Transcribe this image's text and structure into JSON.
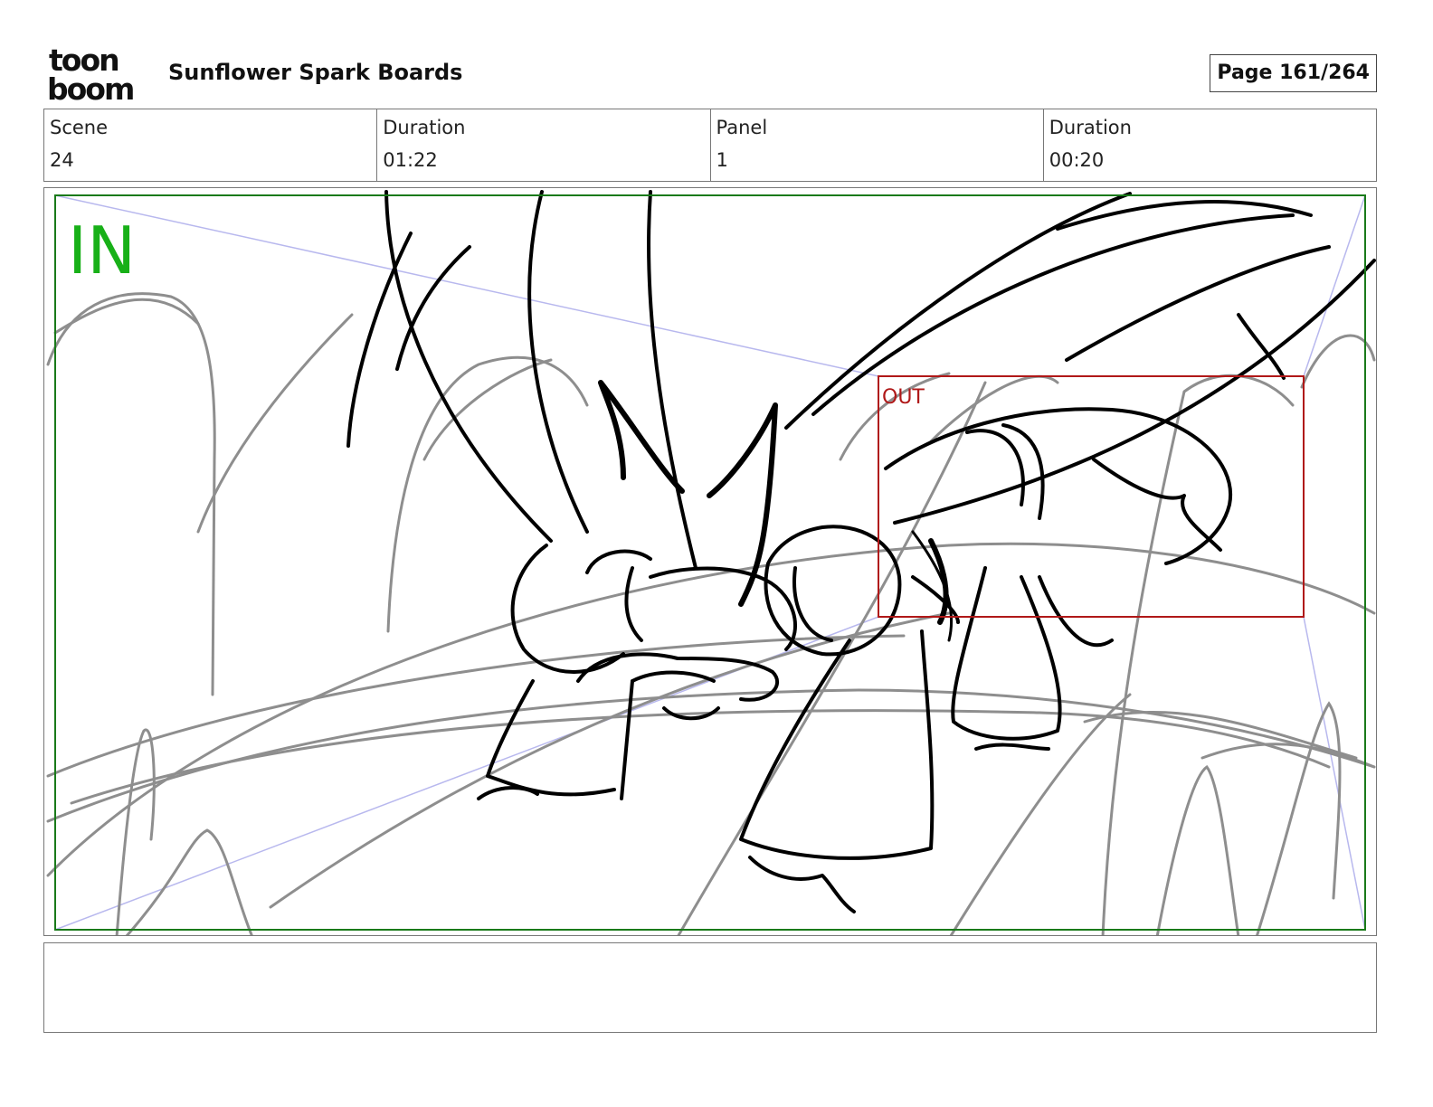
{
  "header": {
    "logo_text_top": "toon",
    "logo_text_bottom": "boom",
    "project_title": "Sunflower Spark Boards",
    "page_indicator": "Page 161/264"
  },
  "info": {
    "scene_label": "Scene",
    "scene_value": "24",
    "scene_duration_label": "Duration",
    "scene_duration_value": "01:22",
    "panel_label": "Panel",
    "panel_value": "1",
    "panel_duration_label": "Duration",
    "panel_duration_value": "00:20"
  },
  "panel": {
    "camera_in_label": "IN",
    "camera_out_label": "OUT",
    "colors": {
      "in_frame": "#1a7a1a",
      "in_text": "#18b018",
      "out_frame": "#b01818",
      "guide_lines": "#b8b8ee",
      "rough_sketch": "#8e8e8e",
      "ink_sketch": "#000000"
    }
  },
  "notes": {
    "text": ""
  }
}
